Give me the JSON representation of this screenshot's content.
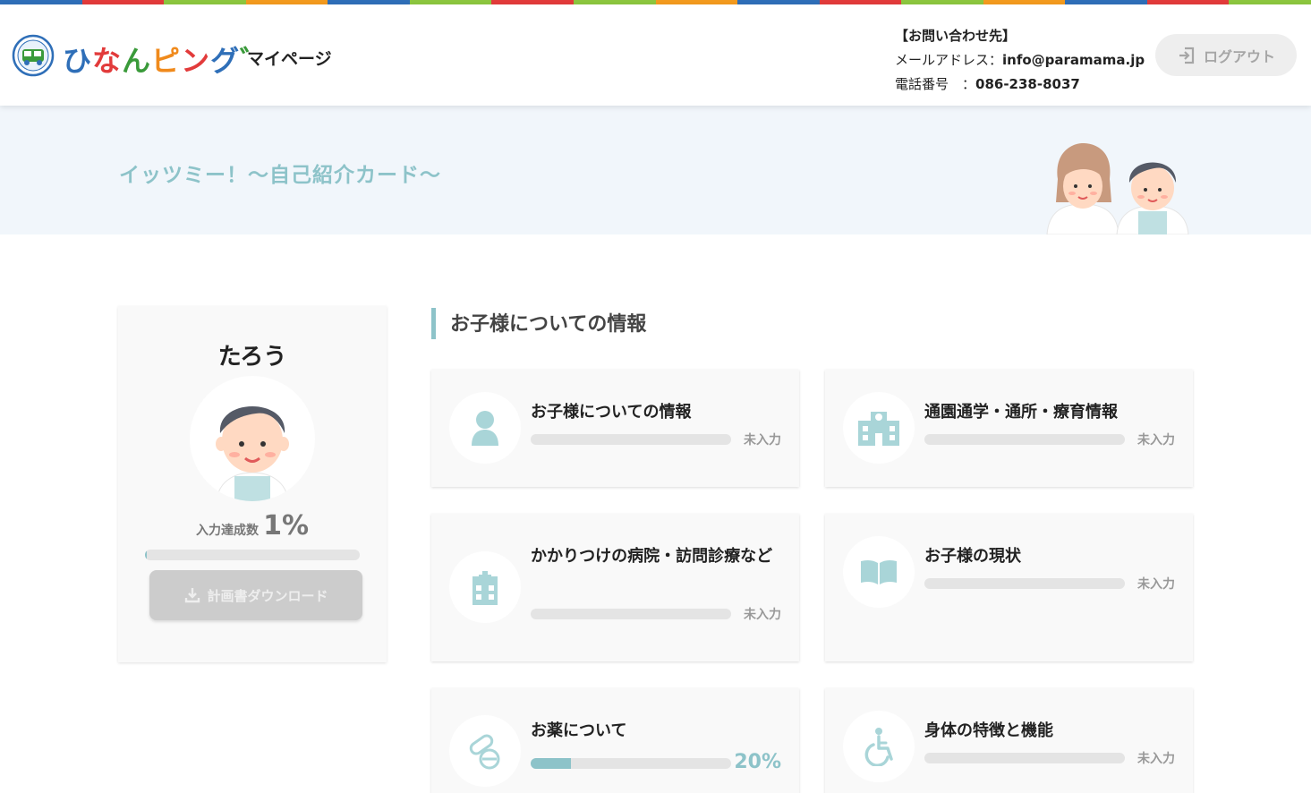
{
  "colors": {
    "accent": "#8dc3c9",
    "rainbow": [
      "#2f6fb8",
      "#e23b3b",
      "#8cc63f",
      "#f39a1e",
      "#2f6fb8",
      "#8cc63f",
      "#e23b3b",
      "#8cc63f",
      "#f39a1e",
      "#2f6fb8",
      "#e23b3b",
      "#8cc63f",
      "#f39a1e",
      "#2f6fb8",
      "#e23b3b",
      "#8cc63f"
    ]
  },
  "header": {
    "logo_chars": [
      "ひ",
      "な",
      "ん",
      "ピ",
      "ン",
      "グ",
      "゛"
    ],
    "mypage_label": "マイページ",
    "contact": {
      "heading": "【お問い合わせ先】",
      "email_label": "メールアドレス：",
      "email": "info@paramama.jp",
      "phone_label": "電話番号　：",
      "phone": "086-238-8037"
    },
    "logout_label": "ログアウト"
  },
  "banner": {
    "title": "イッツミー！～自己紹介カード～"
  },
  "profile": {
    "name": "たろう",
    "rate_label": "入力達成数",
    "rate_value": "1%",
    "rate_fraction": 0.01,
    "download_label": "計画書ダウンロード"
  },
  "main": {
    "section_title": "お子様についての情報",
    "cards": [
      {
        "title": "お子様についての情報",
        "status": "未入力",
        "progress": 0,
        "icon": "person-icon"
      },
      {
        "title": "通園通学・通所・療育情報",
        "status": "未入力",
        "progress": 0,
        "icon": "school-icon"
      },
      {
        "title": "かかりつけの病院・訪問診療など",
        "status": "未入力",
        "progress": 0,
        "icon": "hospital-icon"
      },
      {
        "title": "お子様の現状",
        "status": "未入力",
        "progress": 0,
        "icon": "book-icon"
      },
      {
        "title": "お薬について",
        "status": "20%",
        "progress": 0.2,
        "icon": "medicine-icon"
      },
      {
        "title": "身体の特徴と機能",
        "status": "未入力",
        "progress": 0,
        "icon": "wheelchair-icon"
      }
    ]
  }
}
